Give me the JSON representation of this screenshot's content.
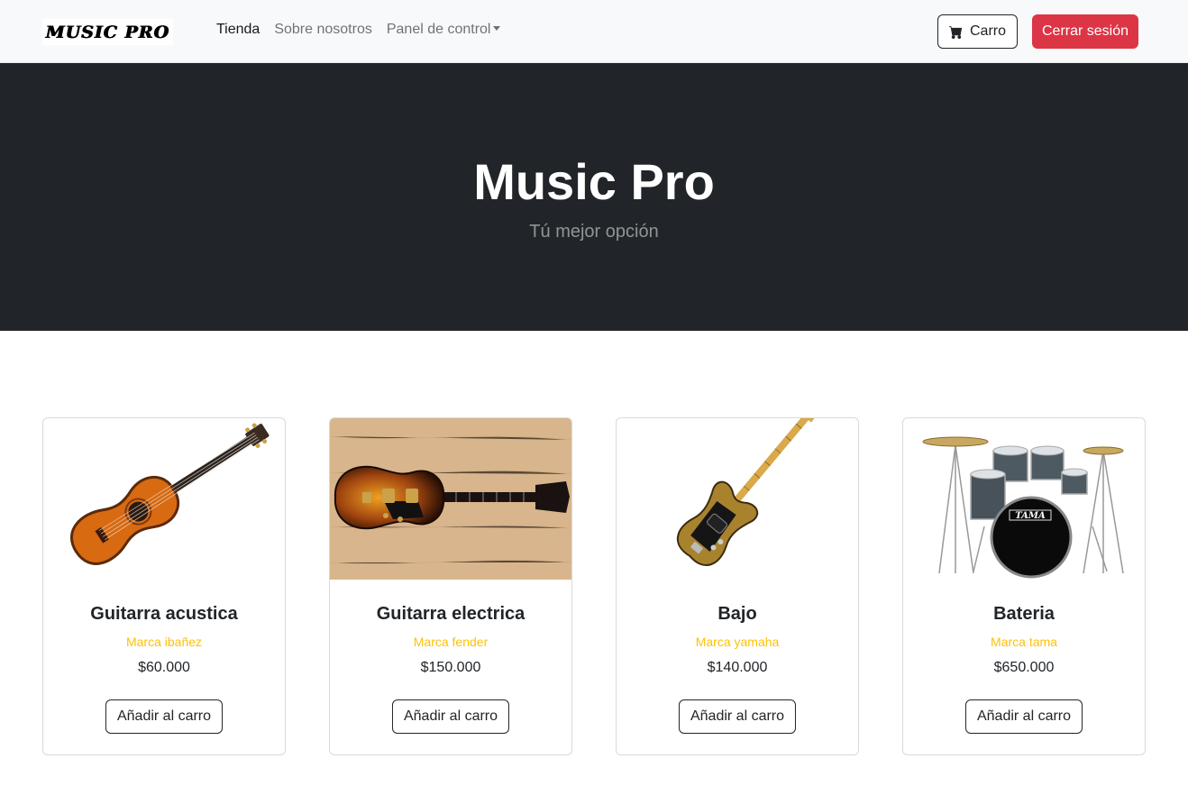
{
  "navbar": {
    "brand_text": "MUSIC PRO",
    "links": [
      {
        "label": "Tienda",
        "active": true
      },
      {
        "label": "Sobre nosotros",
        "active": false
      },
      {
        "label": "Panel de control",
        "active": false,
        "dropdown": true
      }
    ],
    "cart_label": "Carro",
    "cart_icon": "cart-icon",
    "logout_label": "Cerrar sesión"
  },
  "hero": {
    "title": "Music Pro",
    "subtitle": "Tú mejor opción"
  },
  "products": [
    {
      "name": "Guitarra acustica",
      "brand": "Marca ibañez",
      "price": "$60.000",
      "button": "Añadir al carro",
      "image": "acoustic-guitar-image"
    },
    {
      "name": "Guitarra electrica",
      "brand": "Marca fender",
      "price": "$150.000",
      "button": "Añadir al carro",
      "image": "electric-guitar-image"
    },
    {
      "name": "Bajo",
      "brand": "Marca yamaha",
      "price": "$140.000",
      "button": "Añadir al carro",
      "image": "bass-guitar-image"
    },
    {
      "name": "Bateria",
      "brand": "Marca tama",
      "price": "$650.000",
      "button": "Añadir al carro",
      "image": "drum-kit-image"
    }
  ],
  "colors": {
    "navbar_bg": "#f8f9fa",
    "hero_bg": "#212529",
    "logout_bg": "#dc3545",
    "brand_text": "#ffc107"
  }
}
